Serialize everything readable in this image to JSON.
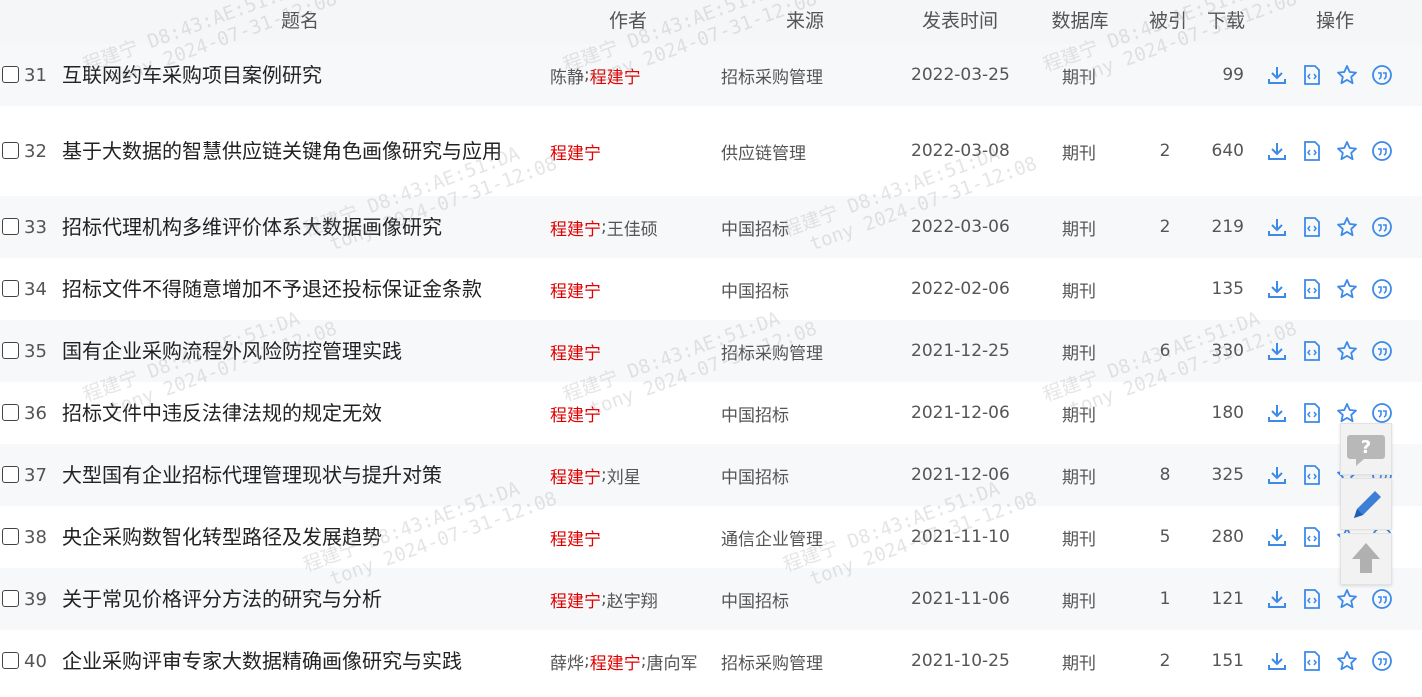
{
  "header": {
    "title": "题名",
    "author": "作者",
    "source": "来源",
    "date": "发表时间",
    "database": "数据库",
    "cited": "被引",
    "downloads": "下载",
    "operations": "操作"
  },
  "rows": [
    {
      "seq": "31",
      "title": "互联网约车采购项目案例研究",
      "authors": [
        {
          "name": "陈静",
          "hl": false
        },
        {
          "name": "程建宁",
          "hl": true
        }
      ],
      "source": "招标采购管理",
      "date": "2022-03-25",
      "db": "期刊",
      "cited": "",
      "downloads": "99"
    },
    {
      "seq": "32",
      "title": "基于大数据的智慧供应链关键角色画像研究与应用",
      "authors": [
        {
          "name": "程建宁",
          "hl": true
        }
      ],
      "source": "供应链管理",
      "date": "2022-03-08",
      "db": "期刊",
      "cited": "2",
      "downloads": "640"
    },
    {
      "seq": "33",
      "title": "招标代理机构多维评价体系大数据画像研究",
      "authors": [
        {
          "name": "程建宁",
          "hl": true
        },
        {
          "name": "王佳硕",
          "hl": false
        }
      ],
      "source": "中国招标",
      "date": "2022-03-06",
      "db": "期刊",
      "cited": "2",
      "downloads": "219"
    },
    {
      "seq": "34",
      "title": "招标文件不得随意增加不予退还投标保证金条款",
      "authors": [
        {
          "name": "程建宁",
          "hl": true
        }
      ],
      "source": "中国招标",
      "date": "2022-02-06",
      "db": "期刊",
      "cited": "",
      "downloads": "135"
    },
    {
      "seq": "35",
      "title": "国有企业采购流程外风险防控管理实践",
      "authors": [
        {
          "name": "程建宁",
          "hl": true
        }
      ],
      "source": "招标采购管理",
      "date": "2021-12-25",
      "db": "期刊",
      "cited": "6",
      "downloads": "330"
    },
    {
      "seq": "36",
      "title": "招标文件中违反法律法规的规定无效",
      "authors": [
        {
          "name": "程建宁",
          "hl": true
        }
      ],
      "source": "中国招标",
      "date": "2021-12-06",
      "db": "期刊",
      "cited": "",
      "downloads": "180"
    },
    {
      "seq": "37",
      "title": "大型国有企业招标代理管理现状与提升对策",
      "authors": [
        {
          "name": "程建宁",
          "hl": true
        },
        {
          "name": "刘星",
          "hl": false
        }
      ],
      "source": "中国招标",
      "date": "2021-12-06",
      "db": "期刊",
      "cited": "8",
      "downloads": "325"
    },
    {
      "seq": "38",
      "title": "央企采购数智化转型路径及发展趋势",
      "authors": [
        {
          "name": "程建宁",
          "hl": true
        }
      ],
      "source": "通信企业管理",
      "date": "2021-11-10",
      "db": "期刊",
      "cited": "5",
      "downloads": "280"
    },
    {
      "seq": "39",
      "title": "关于常见价格评分方法的研究与分析",
      "authors": [
        {
          "name": "程建宁",
          "hl": true
        },
        {
          "name": "赵宇翔",
          "hl": false
        }
      ],
      "source": "中国招标",
      "date": "2021-11-06",
      "db": "期刊",
      "cited": "1",
      "downloads": "121"
    },
    {
      "seq": "40",
      "title": "企业采购评审专家大数据精确画像研究与实践",
      "authors": [
        {
          "name": "薛烨",
          "hl": false
        },
        {
          "name": "程建宁",
          "hl": true
        },
        {
          "name": "唐向军",
          "hl": false
        }
      ],
      "source": "招标采购管理",
      "date": "2021-10-25",
      "db": "期刊",
      "cited": "2",
      "downloads": "151"
    }
  ],
  "row_icons": [
    "download-icon",
    "html-read-icon",
    "favorite-star-icon",
    "quote-icon"
  ],
  "watermark": {
    "line1": "程建宁 D8:43:AE:51:DA",
    "line2": "tony 2024-07-31-12:08"
  },
  "float_tools": [
    "help-icon",
    "edit-pen-icon",
    "back-to-top-icon"
  ],
  "colors": {
    "highlight": "#e00000",
    "icon_blue": "#3d8ae8",
    "header_bg": "#f5f6f8",
    "alt_row_bg": "#f7f8fa"
  }
}
